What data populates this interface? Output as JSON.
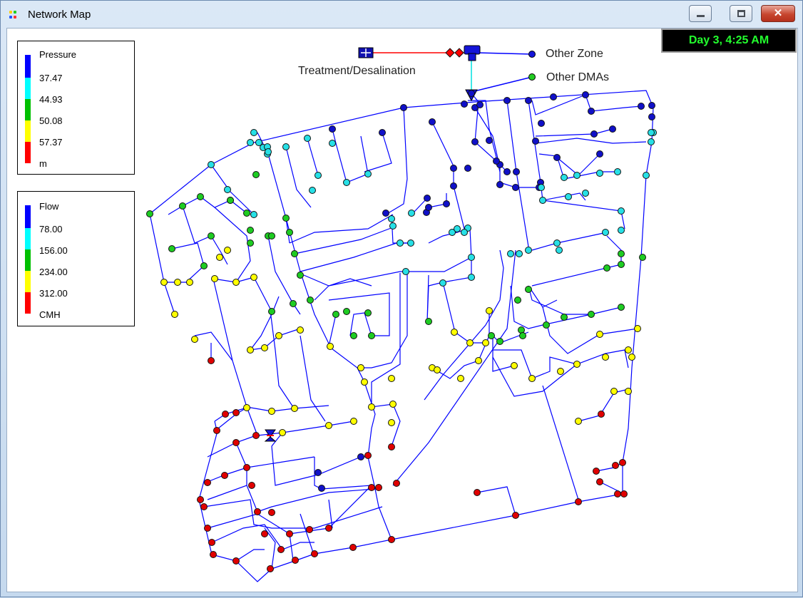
{
  "window": {
    "title": "Network Map",
    "controls": {
      "minimize": "minimize",
      "maximize": "maximize",
      "close": "close"
    }
  },
  "clock": {
    "text": "Day 3, 4:25 AM"
  },
  "labels": {
    "treatment": "Treatment/Desalination",
    "other_zone": "Other Zone",
    "other_dmas": "Other DMAs"
  },
  "pressure_legend": {
    "title": "Pressure",
    "thresholds": [
      "37.47",
      "44.93",
      "50.08",
      "57.37"
    ],
    "unit": "m",
    "colors": [
      "#0000ff",
      "#00ffff",
      "#00c000",
      "#ffff00",
      "#ff0000"
    ]
  },
  "flow_legend": {
    "title": "Flow",
    "thresholds": [
      "78.00",
      "156.00",
      "234.00",
      "312.00"
    ],
    "unit": "CMH",
    "colors": [
      "#0000ff",
      "#00ffff",
      "#00c000",
      "#ffff00",
      "#ff0000"
    ]
  },
  "node_colors": {
    "blue": "#1010c8",
    "cyan": "#27e0e6",
    "green": "#1ecc22",
    "yellow": "#ffff00",
    "red": "#e00000"
  },
  "pipe_colors": {
    "blue": "#0000ff",
    "red": "#ff0000",
    "cyan": "#00e0e0"
  },
  "icons": [
    "network-map-app-icon",
    "reservoir-icon",
    "pump-icon",
    "valve-icon",
    "tank-icon"
  ]
}
